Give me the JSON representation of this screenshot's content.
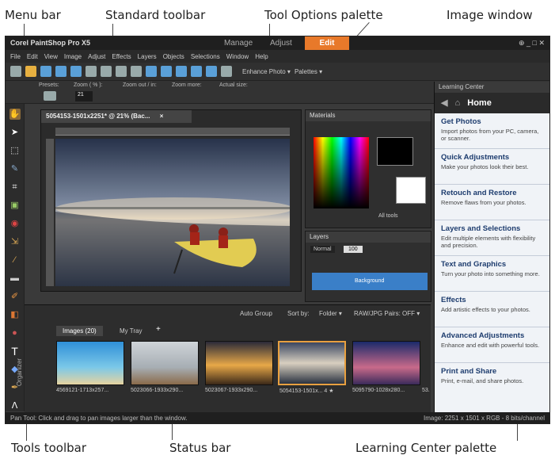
{
  "callouts": {
    "menu_bar": "Menu bar",
    "standard_toolbar": "Standard toolbar",
    "tool_options": "Tool Options palette",
    "image_window": "Image window",
    "tools_toolbar": "Tools toolbar",
    "status_bar": "Status bar",
    "learning_center": "Learning Center palette"
  },
  "app": {
    "brand": "Corel PaintShop Pro X5",
    "tabs": [
      "Manage",
      "Adjust",
      "Edit"
    ],
    "active_tab": "Edit",
    "window_controls": "⊕ _ □ ✕"
  },
  "menu": [
    "File",
    "Edit",
    "View",
    "Image",
    "Adjust",
    "Effects",
    "Layers",
    "Objects",
    "Selections",
    "Window",
    "Help"
  ],
  "toolbar": {
    "enhance_photo": "Enhance Photo ▾",
    "palettes": "Palettes ▾"
  },
  "tool_options": {
    "presets": "Presets:",
    "zoom": "Zoom ( % ):",
    "zoom_value": "21",
    "zoom_out_in": "Zoom out / in:",
    "zoom_more": "Zoom more:",
    "actual_size": "Actual size:"
  },
  "document": {
    "tab_title": "5054153-1501x2251* @  21% (Bac...",
    "close": "×"
  },
  "materials": {
    "title": "Materials",
    "all_tools": "All tools"
  },
  "layers": {
    "title": "Layers",
    "blend_mode": "Normal",
    "opacity": "100",
    "layer_name": "Background"
  },
  "organizer": {
    "side_label": "Organizer",
    "auto_group": "Auto Group",
    "sort_by": "Sort by:",
    "folder": "Folder ▾",
    "raw_pairs": "RAW/JPG Pairs: OFF ▾",
    "tabs": [
      "Images (20)",
      "My Tray",
      "+"
    ],
    "thumbnails": [
      "4569121-1713x257...",
      "5023066-1933x290...",
      "5023067-1933x290...",
      "5054153-1501x... 4 ★",
      "5095790-1028x280...",
      "53..."
    ]
  },
  "learning_center": {
    "title": "Learning Center",
    "home": "Home",
    "items": [
      {
        "title": "Get Photos",
        "desc": "Import photos from your PC, camera, or scanner."
      },
      {
        "title": "Quick Adjustments",
        "desc": "Make your photos look their best."
      },
      {
        "title": "Retouch and Restore",
        "desc": "Remove flaws from your photos."
      },
      {
        "title": "Layers and Selections",
        "desc": "Edit multiple elements with flexibility and precision."
      },
      {
        "title": "Text and Graphics",
        "desc": "Turn your photo into something more."
      },
      {
        "title": "Effects",
        "desc": "Add artistic effects to your photos."
      },
      {
        "title": "Advanced Adjustments",
        "desc": "Enhance and edit with powerful tools."
      },
      {
        "title": "Print and Share",
        "desc": "Print, e-mail, and share photos."
      }
    ]
  },
  "status": {
    "left": "Pan Tool: Click and drag to pan images larger than the window.",
    "right": "Image: 2251 x 1501 x RGB - 8 bits/channel"
  },
  "colors": {
    "accent": "#e8792a",
    "app_bg": "#3a3a3a",
    "learning_bg": "#f0f3f7"
  }
}
